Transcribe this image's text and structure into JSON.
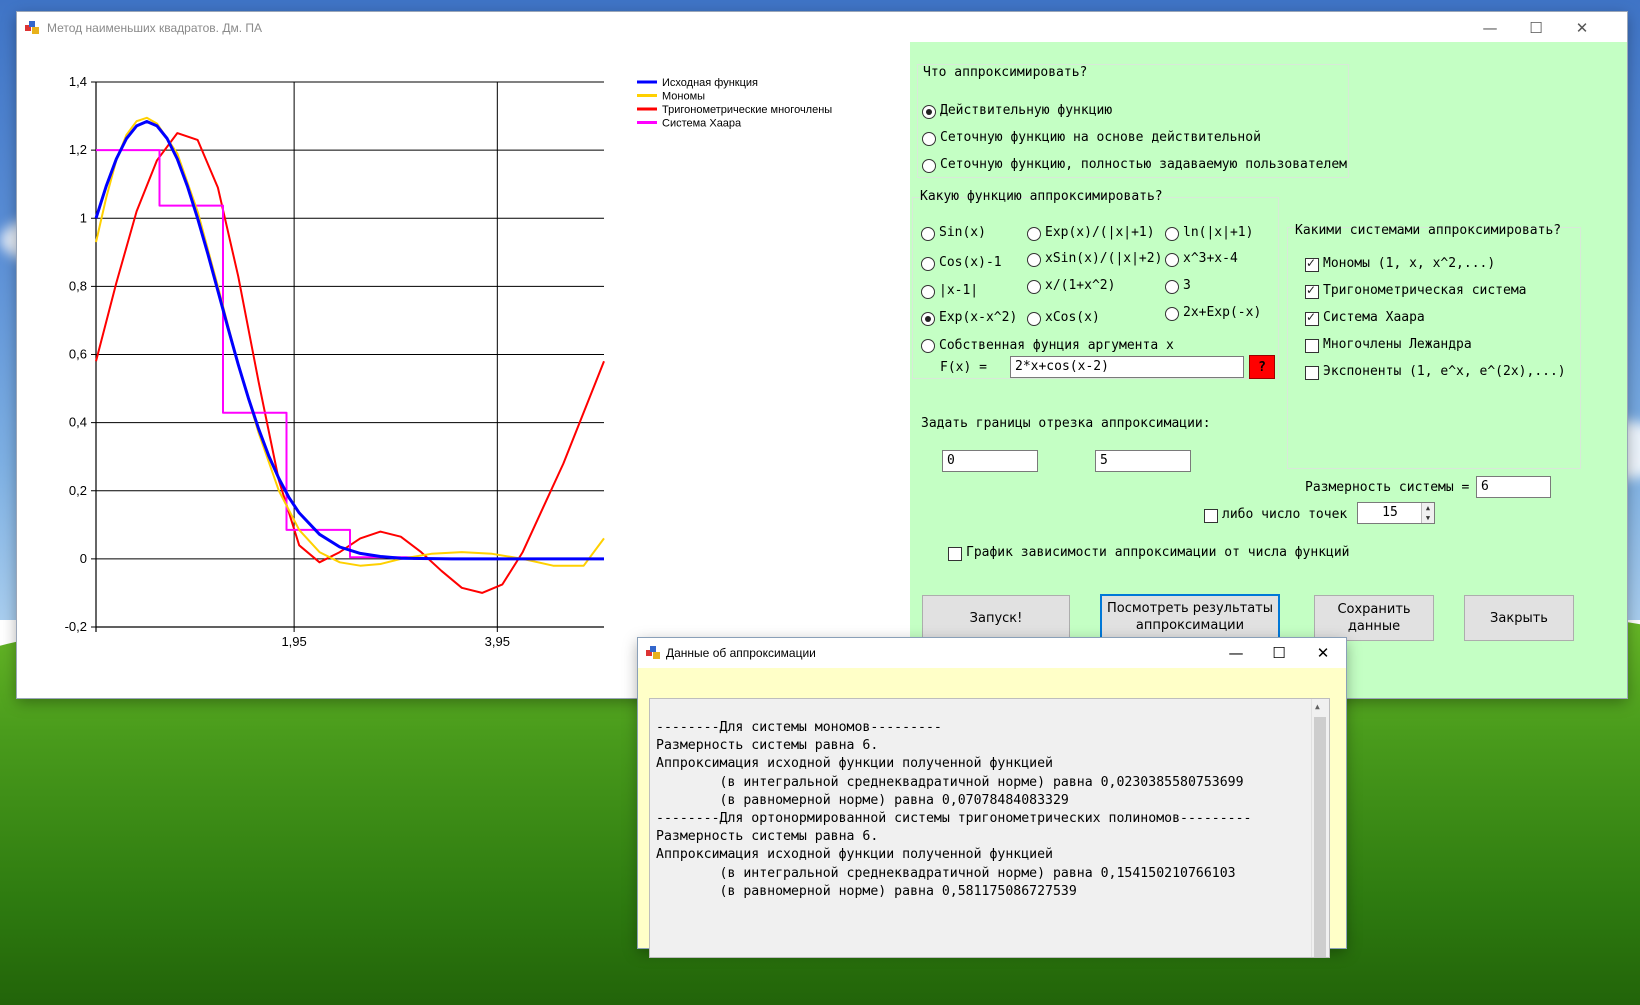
{
  "main_window": {
    "title": "Метод наименьших квадратов. Дм. ПА",
    "minimize": "—",
    "maximize": "☐",
    "close": "✕"
  },
  "chart_data": {
    "type": "line",
    "xlim": [
      0,
      5
    ],
    "ylim": [
      -0.2,
      1.4
    ],
    "x_ticks": [
      "1,95",
      "3,95"
    ],
    "y_ticks": [
      "1,4",
      "1,2",
      "1",
      "0,8",
      "0,6",
      "0,4",
      "0,2",
      "0",
      "-0,2"
    ],
    "grid": true,
    "legend_position": "top-right",
    "series": [
      {
        "name": "Исходная функция",
        "color": "#0000ff",
        "x": [
          0,
          0.1,
          0.2,
          0.3,
          0.4,
          0.5,
          0.6,
          0.7,
          0.8,
          0.9,
          1.0,
          1.1,
          1.2,
          1.3,
          1.4,
          1.5,
          1.6,
          1.7,
          1.8,
          1.9,
          2.0,
          2.2,
          2.4,
          2.6,
          2.8,
          3.0,
          3.5,
          4.0,
          4.5,
          5.0
        ],
        "y": [
          1.0,
          1.094,
          1.174,
          1.234,
          1.271,
          1.284,
          1.271,
          1.234,
          1.174,
          1.094,
          1.0,
          0.896,
          0.787,
          0.677,
          0.571,
          0.472,
          0.382,
          0.303,
          0.236,
          0.18,
          0.135,
          0.072,
          0.035,
          0.016,
          0.007,
          0.002,
          0.0,
          0.0,
          0.0,
          0.0
        ]
      },
      {
        "name": "Мономы",
        "color": "#ffd000",
        "x": [
          0,
          0.1,
          0.2,
          0.3,
          0.4,
          0.5,
          0.6,
          0.8,
          1.0,
          1.2,
          1.4,
          1.6,
          1.8,
          2.0,
          2.2,
          2.4,
          2.6,
          2.8,
          3.0,
          3.3,
          3.6,
          3.9,
          4.2,
          4.5,
          4.8,
          5.0
        ],
        "y": [
          0.93,
          1.06,
          1.17,
          1.245,
          1.285,
          1.295,
          1.278,
          1.19,
          1.02,
          0.8,
          0.57,
          0.37,
          0.2,
          0.085,
          0.02,
          -0.01,
          -0.02,
          -0.015,
          0.0,
          0.015,
          0.02,
          0.015,
          0.0,
          -0.02,
          -0.02,
          0.06
        ]
      },
      {
        "name": "Тригонометрические многочлены",
        "color": "#ff0000",
        "x": [
          0,
          0.2,
          0.4,
          0.6,
          0.8,
          1.0,
          1.2,
          1.4,
          1.6,
          1.8,
          2.0,
          2.2,
          2.4,
          2.6,
          2.8,
          3.0,
          3.2,
          3.4,
          3.6,
          3.8,
          4.0,
          4.2,
          4.4,
          4.6,
          4.8,
          5.0
        ],
        "y": [
          0.58,
          0.81,
          1.02,
          1.17,
          1.25,
          1.23,
          1.09,
          0.83,
          0.52,
          0.23,
          0.04,
          -0.01,
          0.02,
          0.06,
          0.08,
          0.065,
          0.02,
          -0.035,
          -0.085,
          -0.1,
          -0.075,
          0.02,
          0.15,
          0.28,
          0.43,
          0.58
        ]
      },
      {
        "name": "Система Хаара",
        "color": "#ff00ff",
        "x": [
          0,
          0.625,
          0.625,
          1.25,
          1.25,
          1.875,
          1.875,
          2.5,
          2.5,
          3.125,
          3.125,
          3.75,
          3.75,
          4.375,
          4.375,
          5.0
        ],
        "y": [
          1.2,
          1.2,
          1.037,
          1.037,
          0.429,
          0.429,
          0.085,
          0.085,
          0.005,
          0.005,
          0.0,
          0.0,
          0.0,
          0.0,
          0.0,
          0.0
        ]
      }
    ]
  },
  "panel": {
    "q1": {
      "label": "Что аппроксимировать?",
      "options": [
        {
          "label": "Действительную функцию",
          "checked": true
        },
        {
          "label": "Сеточную функцию на основе действительной",
          "checked": false
        },
        {
          "label": "Сеточную функцию, полностью задаваемую пользователем",
          "checked": false
        }
      ]
    },
    "q2": {
      "label": "Какую функцию аппроксимировать?",
      "col1": [
        {
          "label": "Sin(x)",
          "checked": false
        },
        {
          "label": "Cos(x)-1",
          "checked": false
        },
        {
          "label": "|x-1|",
          "checked": false
        },
        {
          "label": "Exp(x-x^2)",
          "checked": true
        }
      ],
      "col2": [
        {
          "label": "Exp(x)/(|x|+1)",
          "checked": false
        },
        {
          "label": "xSin(x)/(|x|+2)",
          "checked": false
        },
        {
          "label": "x/(1+x^2)",
          "checked": false
        },
        {
          "label": "xCos(x)",
          "checked": false
        }
      ],
      "col3": [
        {
          "label": "ln(|x|+1)",
          "checked": false
        },
        {
          "label": "x^3+x-4",
          "checked": false
        },
        {
          "label": "3",
          "checked": false
        },
        {
          "label": "2x+Exp(-x)",
          "checked": false
        }
      ],
      "custom": {
        "label": "Собственная фунция аргумента x",
        "checked": false
      },
      "fx_label": "F(x) =",
      "fx_value": "2*x+cos(x-2)",
      "help": "?"
    },
    "q3": {
      "label": "Какими системами аппроксимировать?",
      "options": [
        {
          "label": "Мономы (1, x, x^2,...)",
          "checked": true
        },
        {
          "label": "Тригонометрическая система",
          "checked": true
        },
        {
          "label": "Система Хаара",
          "checked": true
        },
        {
          "label": "Многочлены Лежандра",
          "checked": false
        },
        {
          "label": "Экспоненты (1, e^x, e^(2x),...)",
          "checked": false
        }
      ]
    },
    "bounds": {
      "label": "Задать границы отрезка аппроксимации:",
      "a": "0",
      "b": "5"
    },
    "dim": {
      "label": "Размерность системы =",
      "value": "6"
    },
    "points": {
      "label": "либо число точек",
      "checked": false,
      "value": "15"
    },
    "graph_option": {
      "label": "График зависимости аппроксимации от числа функций",
      "checked": false
    },
    "buttons": {
      "run": "Запуск!",
      "view": "Посмотреть результаты аппроксимации",
      "save": "Сохранить данные",
      "close": "Закрыть"
    }
  },
  "dialog": {
    "title": "Данные об аппроксимации",
    "minimize": "—",
    "maximize": "☐",
    "close": "✕",
    "lines": [
      "--------Для системы мономов---------",
      "Размерность системы равна 6.",
      "Аппроксимация исходной функции полученной функцией",
      "        (в интегральной среднеквадратичной норме) равна 0,0230385580753699",
      "        (в равномерной норме) равна 0,07078484083329",
      "--------Для ортонормированной системы тригонометрических полиномов---------",
      "Размерность системы равна 6.",
      "Аппроксимация исходной функции полученной функцией",
      "        (в интегральной среднеквадратичной норме) равна 0,154150210766103",
      "        (в равномерной норме) равна 0,581175086727539"
    ]
  }
}
